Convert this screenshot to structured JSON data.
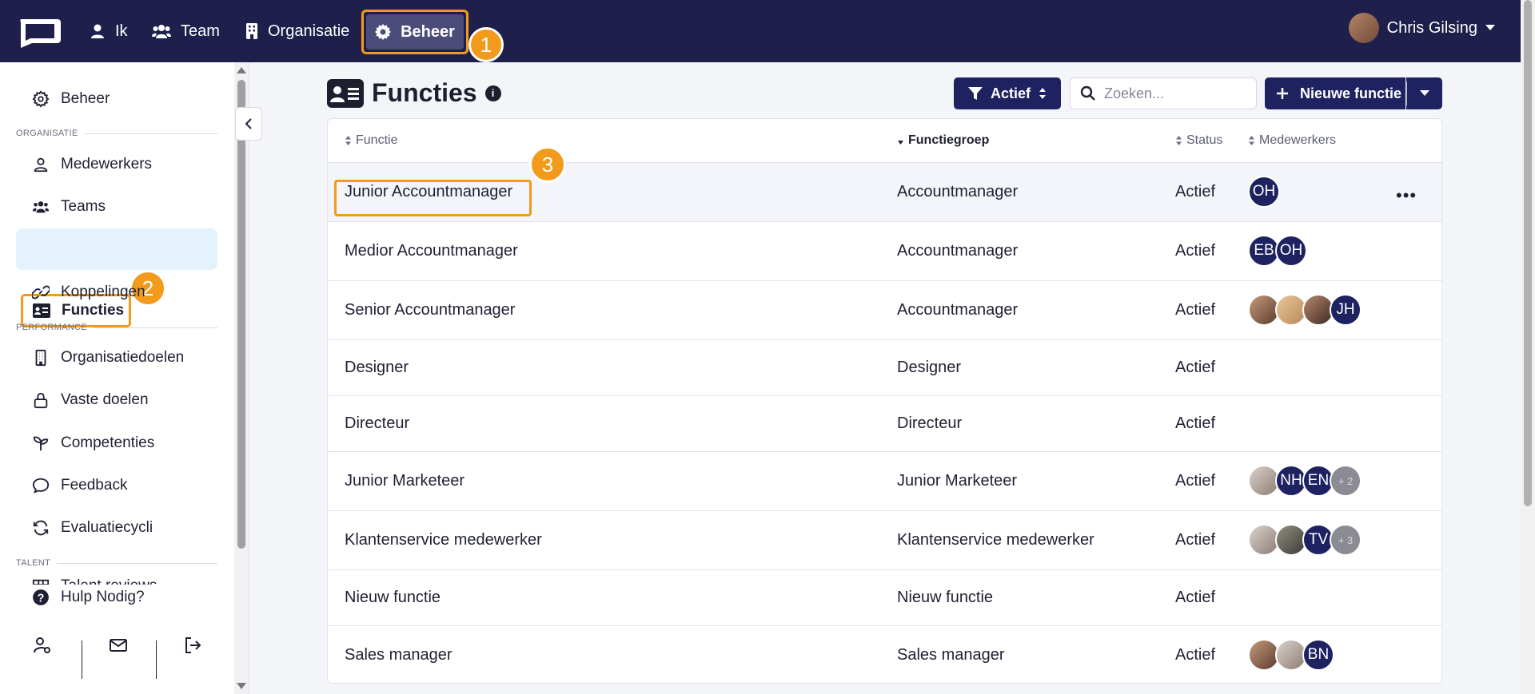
{
  "nav": {
    "items": [
      "Ik",
      "Team",
      "Organisatie"
    ],
    "active": "Beheer",
    "user_name": "Chris Gilsing"
  },
  "badges": [
    "1",
    "2",
    "3"
  ],
  "sidebar": {
    "top_item": "Beheer",
    "sections": {
      "organisatie": "ORGANISATIE",
      "performance": "PERFORMANCE",
      "talent": "TALENT"
    },
    "organisatie_items": [
      "Medewerkers",
      "Teams",
      "Functies",
      "Koppelingen"
    ],
    "performance_items": [
      "Organisatiedoelen",
      "Vaste doelen",
      "Competenties",
      "Feedback",
      "Evaluatiecycli"
    ],
    "talent_items": [
      "Talent reviews"
    ],
    "help": "Hulp Nodig?"
  },
  "page": {
    "title": "Functies",
    "filter_label": "Actief",
    "search_placeholder": "Zoeken...",
    "new_button": "Nieuwe functie"
  },
  "table": {
    "columns": [
      "Functie",
      "Functiegroep",
      "Status",
      "Medewerkers"
    ],
    "rows": [
      {
        "functie": "Junior Accountmanager",
        "groep": "Accountmanager",
        "status": "Actief",
        "avatars": [
          "OH"
        ]
      },
      {
        "functie": "Medior Accountmanager",
        "groep": "Accountmanager",
        "status": "Actief",
        "avatars": [
          "EB",
          "OH"
        ]
      },
      {
        "functie": "Senior Accountmanager",
        "groep": "Accountmanager",
        "status": "Actief",
        "avatars": [
          "photo",
          "photo",
          "photo",
          "JH"
        ]
      },
      {
        "functie": "Designer",
        "groep": "Designer",
        "status": "Actief",
        "avatars": []
      },
      {
        "functie": "Directeur",
        "groep": "Directeur",
        "status": "Actief",
        "avatars": []
      },
      {
        "functie": "Junior Marketeer",
        "groep": "Junior Marketeer",
        "status": "Actief",
        "avatars": [
          "photo",
          "NH",
          "EN",
          "+ 2"
        ]
      },
      {
        "functie": "Klantenservice medewerker",
        "groep": "Klantenservice medewerker",
        "status": "Actief",
        "avatars": [
          "photo",
          "photo",
          "TV",
          "+ 3"
        ]
      },
      {
        "functie": "Nieuw functie",
        "groep": "Nieuw functie",
        "status": "Actief",
        "avatars": []
      },
      {
        "functie": "Sales manager",
        "groep": "Sales manager",
        "status": "Actief",
        "avatars": [
          "photo",
          "photo",
          "BN"
        ]
      }
    ]
  }
}
